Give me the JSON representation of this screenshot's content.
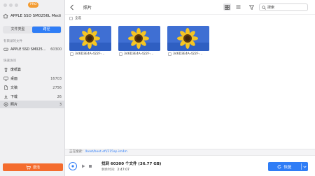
{
  "sidebar": {
    "pro_badge": "PRO",
    "drive_name": "APPLE SSD SM0256L Medi",
    "tabs": [
      {
        "label": "文件类型",
        "active": false
      },
      {
        "label": "路径",
        "active": true
      }
    ],
    "scanned_section_label": "有目录的文件",
    "scanned_item": {
      "label": "APPLE SSD SM025...",
      "count": "60300"
    },
    "quick_section_label": "快速访问",
    "quick_items": [
      {
        "label": "废纸篓",
        "count": "",
        "icon": "trash-icon"
      },
      {
        "label": "桌面",
        "count": "16703",
        "icon": "desktop-icon"
      },
      {
        "label": "文稿",
        "count": "2756",
        "icon": "document-icon"
      },
      {
        "label": "下载",
        "count": "26",
        "icon": "download-icon"
      },
      {
        "label": "照片",
        "count": "3",
        "icon": "photo-icon",
        "selected": true
      }
    ],
    "activate_label": "激活"
  },
  "toolbar": {
    "title": "照片",
    "search_placeholder": "搜索"
  },
  "select_all_label": "全选",
  "files": [
    {
      "name": "346D3E4A-422F-..."
    },
    {
      "name": "346D3E4A-422F-..."
    },
    {
      "name": "346D3E4A-422F-..."
    }
  ],
  "status": {
    "label": "正在搜索：",
    "path": "/boot/boot.efi/215ap.im4m"
  },
  "bottom": {
    "found_text": "找到 60300 个文件 (36.77 GB)",
    "time_label": "剩余时间:",
    "time_value": "2:47:07",
    "recover_label": "恢复"
  },
  "colors": {
    "accent": "#2f7df6",
    "activate": "#f46c2e",
    "pro_badge": "#f39c33"
  }
}
